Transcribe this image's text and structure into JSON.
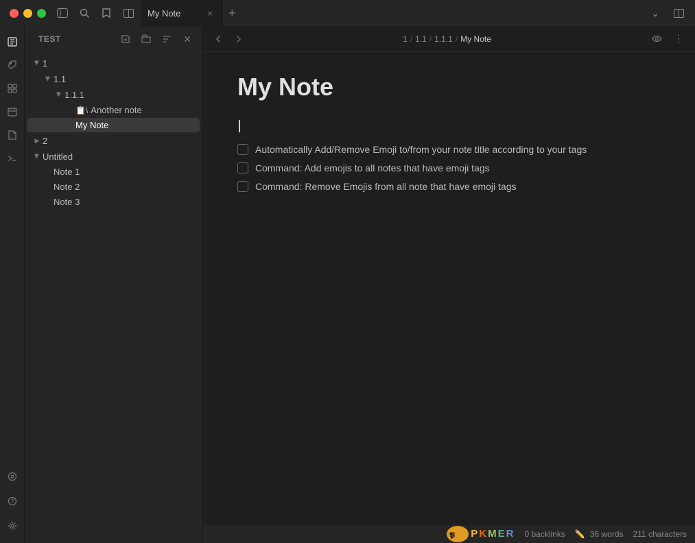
{
  "titleBar": {
    "tabLabel": "My Note",
    "newTabLabel": "+",
    "closeTabLabel": "×",
    "icons": {
      "sidebar": "⊞",
      "search": "⌕",
      "bookmark": "🔖",
      "layout": "⊡",
      "chevronDown": "⌄",
      "splitView": "⊟"
    }
  },
  "sidebar": {
    "sectionLabel": "Test",
    "toolbar": {
      "newNote": "✎",
      "newFolder": "📁",
      "sort": "≡",
      "close": "✕"
    },
    "tree": {
      "items": [
        {
          "id": "1",
          "label": "1",
          "level": 0,
          "expanded": true,
          "hasArrow": true
        },
        {
          "id": "1.1",
          "label": "1.1",
          "level": 1,
          "expanded": true,
          "hasArrow": true
        },
        {
          "id": "1.1.1",
          "label": "1.1.1",
          "level": 2,
          "expanded": true,
          "hasArrow": true
        },
        {
          "id": "another-note",
          "label": "Another note",
          "level": 3,
          "hasIcon": "📋",
          "hasArrow": false
        },
        {
          "id": "my-note",
          "label": "My Note",
          "level": 3,
          "hasArrow": false,
          "selected": true
        },
        {
          "id": "2",
          "label": "2",
          "level": 0,
          "expanded": false,
          "hasArrow": true
        },
        {
          "id": "untitled",
          "label": "Untitled",
          "level": 0,
          "expanded": true,
          "hasArrow": true
        },
        {
          "id": "note-1",
          "label": "Note 1",
          "level": 1,
          "hasArrow": false
        },
        {
          "id": "note-2",
          "label": "Note 2",
          "level": 1,
          "hasArrow": false
        },
        {
          "id": "note-3",
          "label": "Note 3",
          "level": 1,
          "hasArrow": false
        }
      ]
    }
  },
  "editor": {
    "breadcrumb": {
      "parts": [
        "1",
        "/",
        "1.1",
        "/",
        "1.1.1",
        "/",
        "My Note"
      ]
    },
    "noteTitle": "My Note",
    "checklistItems": [
      {
        "text": "Automatically Add/Remove Emoji to/from your note title according to your tags",
        "checked": false
      },
      {
        "text": "Command: Add emojis to all notes  that have emoji tags",
        "checked": false
      },
      {
        "text": "Command: Remove Emojis from all note that have emoji tags",
        "checked": false
      }
    ]
  },
  "statusBar": {
    "backlinks": "0 backlinks",
    "words": "36 words",
    "characters": "211 characters",
    "pkmerText": "PKMER"
  }
}
